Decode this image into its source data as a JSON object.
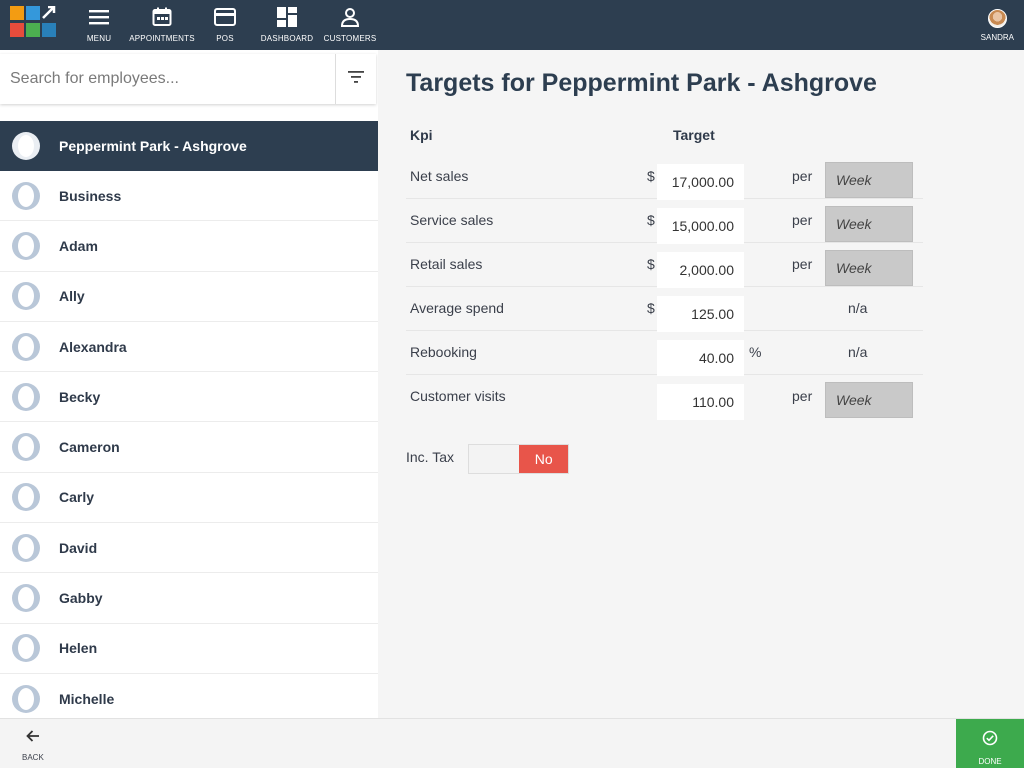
{
  "topbar": {
    "nav": [
      {
        "label": "MENU",
        "icon": "menu-icon"
      },
      {
        "label": "APPOINTMENTS",
        "icon": "calendar-icon"
      },
      {
        "label": "POS",
        "icon": "credit-card-icon"
      },
      {
        "label": "DASHBOARD",
        "icon": "dashboard-icon"
      },
      {
        "label": "CUSTOMERS",
        "icon": "person-icon"
      }
    ],
    "user": "SANDRA",
    "logo_colors": [
      "#f39c12",
      "#3498db",
      "#e74c3c",
      "#4caf50"
    ]
  },
  "sidebar": {
    "search_placeholder": "Search for employees...",
    "items": [
      {
        "name": "Peppermint Park - Ashgrove",
        "selected": true
      },
      {
        "name": "Business"
      },
      {
        "name": "Adam"
      },
      {
        "name": "Ally"
      },
      {
        "name": "Alexandra"
      },
      {
        "name": "Becky"
      },
      {
        "name": "Cameron"
      },
      {
        "name": "Carly"
      },
      {
        "name": "David"
      },
      {
        "name": "Gabby"
      },
      {
        "name": "Helen"
      },
      {
        "name": "Michelle"
      }
    ]
  },
  "main": {
    "title": "Targets for Peppermint Park - Ashgrove",
    "col_kpi": "Kpi",
    "col_target": "Target",
    "rows": [
      {
        "kpi": "Net sales",
        "currency": "$",
        "value": "17,000.00",
        "per": "per",
        "period": "Week"
      },
      {
        "kpi": "Service sales",
        "currency": "$",
        "value": "15,000.00",
        "per": "per",
        "period": "Week"
      },
      {
        "kpi": "Retail sales",
        "currency": "$",
        "value": "2,000.00",
        "per": "per",
        "period": "Week"
      },
      {
        "kpi": "Average spend",
        "currency": "$",
        "value": "125.00",
        "na": "n/a"
      },
      {
        "kpi": "Rebooking",
        "value": "40.00",
        "pct": "%",
        "na": "n/a"
      },
      {
        "kpi": "Customer visits",
        "value": "110.00",
        "per": "per",
        "period": "Week"
      }
    ],
    "inc_tax_label": "Inc. Tax",
    "inc_tax_value": "No"
  },
  "bottom": {
    "back_label": "BACK",
    "done_label": "DONE"
  },
  "colors": {
    "nav_bg": "#2d3e50",
    "toggle_no": "#e8554a",
    "done_bg": "#3daa4d"
  }
}
